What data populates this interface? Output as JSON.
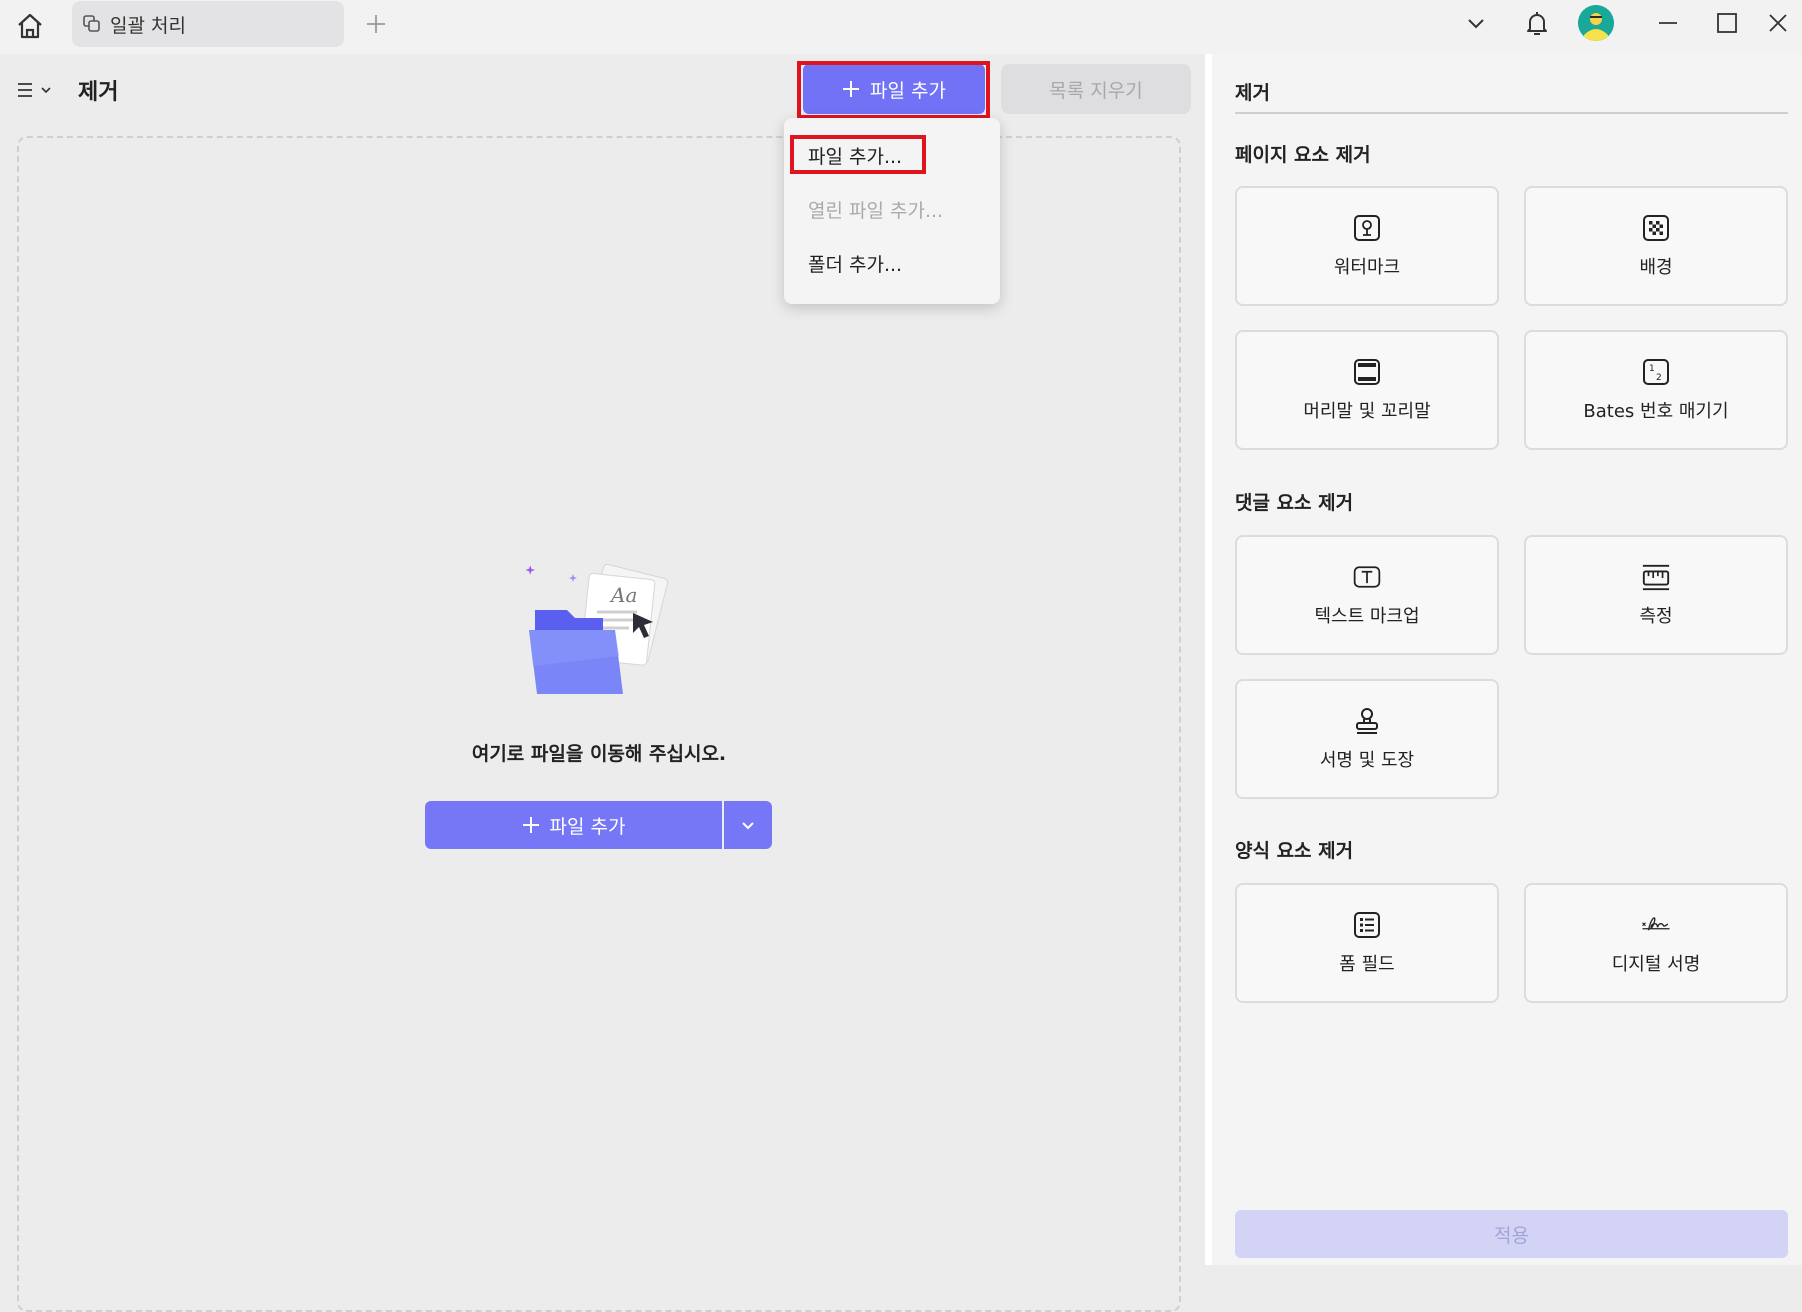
{
  "titlebar": {
    "tab_label": "일괄 처리"
  },
  "main": {
    "title": "제거",
    "add_file_label": "파일 추가",
    "clear_list_label": "목록 지우기",
    "drop_hint": "여기로 파일을 이동해 주십시오.",
    "center_add_label": "파일 추가"
  },
  "dropdown": {
    "items": [
      {
        "label": "파일 추가...",
        "disabled": false
      },
      {
        "label": "열린 파일 추가...",
        "disabled": true
      },
      {
        "label": "폴더 추가...",
        "disabled": false
      }
    ]
  },
  "side": {
    "title": "제거",
    "sections": [
      {
        "title": "페이지 요소 제거",
        "items": [
          {
            "label": "워터마크",
            "icon": "watermark-icon"
          },
          {
            "label": "배경",
            "icon": "background-icon"
          },
          {
            "label": "머리말 및 꼬리말",
            "icon": "header-footer-icon"
          },
          {
            "label": "Bates 번호 매기기",
            "icon": "bates-number-icon"
          }
        ]
      },
      {
        "title": "댓글 요소 제거",
        "items": [
          {
            "label": "텍스트 마크업",
            "icon": "text-markup-icon"
          },
          {
            "label": "측정",
            "icon": "measure-icon"
          },
          {
            "label": "서명 및 도장",
            "icon": "stamp-icon"
          }
        ]
      },
      {
        "title": "양식 요소 제거",
        "items": [
          {
            "label": "폼 필드",
            "icon": "form-field-icon"
          },
          {
            "label": "디지털 서명",
            "icon": "digital-signature-icon"
          }
        ]
      }
    ],
    "apply_label": "적용"
  },
  "colors": {
    "accent": "#7172f6",
    "highlight": "#e0141e"
  }
}
